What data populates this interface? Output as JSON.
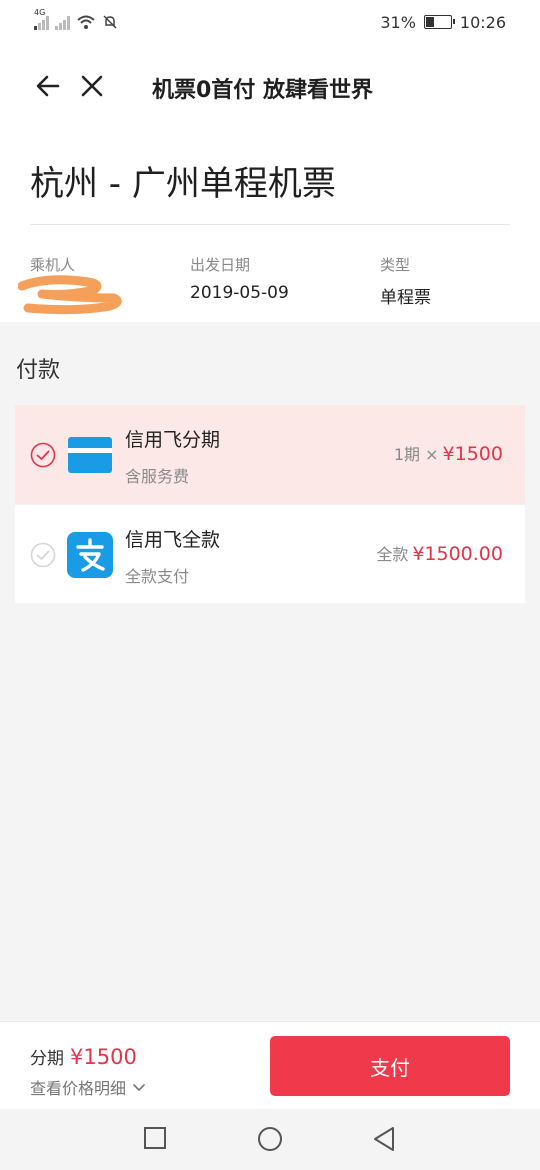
{
  "status": {
    "network_tag": "4G",
    "battery": "31%",
    "time": "10:26"
  },
  "nav": {
    "title": "机票0首付 放肆看世界"
  },
  "trip": {
    "title": "杭州 - 广州单程机票",
    "passenger_label": "乘机人",
    "date_label": "出发日期",
    "date_value": "2019-05-09",
    "type_label": "类型",
    "type_value": "单程票"
  },
  "payment": {
    "section_title": "付款",
    "options": [
      {
        "name": "信用飞分期",
        "desc": "含服务费",
        "price_prefix": "1期 ×",
        "price": "¥1500",
        "selected": true
      },
      {
        "name": "信用飞全款",
        "desc": "全款支付",
        "price_prefix": "全款",
        "price": "¥1500.00",
        "selected": false
      }
    ]
  },
  "bottom": {
    "label": "分期",
    "amount": "¥1500",
    "detail": "查看价格明细",
    "pay_button": "支付"
  },
  "colors": {
    "accent": "#f03a4b",
    "price": "#e5344a",
    "selected_bg": "#fde8e8",
    "alipay": "#1a9be6"
  },
  "icons": {
    "back": "arrow-left-icon",
    "close": "close-icon",
    "card": "credit-card-icon",
    "alipay": "alipay-icon",
    "chevron": "chevron-down-icon"
  }
}
